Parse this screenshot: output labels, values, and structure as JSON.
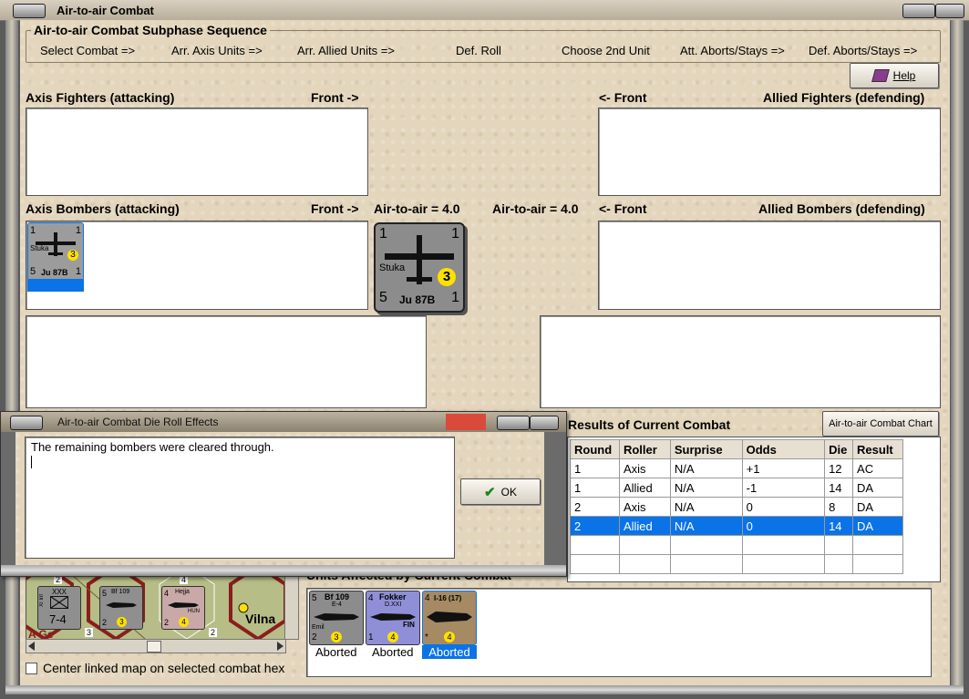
{
  "window": {
    "title": "Air-to-air Combat"
  },
  "sequence": {
    "title": "Air-to-air Combat Subphase Sequence",
    "steps": [
      "Select Combat =>",
      "Arr. Axis Units =>",
      "Arr. Allied Units =>",
      "Def. Roll",
      "Choose 2nd Unit",
      "Att. Aborts/Stays =>",
      "Def. Aborts/Stays =>"
    ]
  },
  "help_button": "Help",
  "labels": {
    "axis_fighters": "Axis Fighters (attacking)",
    "front_right": "Front ->",
    "front_left": "<- Front",
    "allied_fighters": "Allied Fighters (defending)",
    "axis_bombers": "Axis Bombers (attacking)",
    "allied_bombers": "Allied Bombers (defending)",
    "axis_air": "Air-to-air = 4.0",
    "allied_air": "Air-to-air = 4.0"
  },
  "units": {
    "stuka_small": {
      "top_left": "1",
      "top_right": "1",
      "name": "Stuka",
      "type": "Ju 87B",
      "bottom_left": "5",
      "bottom_right": "1",
      "circle": "3"
    },
    "stuka_large": {
      "top_left": "1",
      "top_right": "1",
      "name": "Stuka",
      "type": "Ju 87B",
      "bottom_left": "5",
      "bottom_right": "1",
      "circle": "3"
    }
  },
  "dialog": {
    "title": "Air-to-air Combat Die Roll Effects",
    "message": "The remaining bombers were cleared through.",
    "ok": "OK"
  },
  "results": {
    "title": "Results of Current Combat",
    "chart_button": "Air-to-air Combat Chart",
    "columns": [
      "Round",
      "Roller",
      "Surprise",
      "Odds",
      "Die",
      "Result"
    ],
    "rows": [
      [
        "1",
        "Axis",
        "N/A",
        "+1",
        "12",
        "AC"
      ],
      [
        "1",
        "Allied",
        "N/A",
        "-1",
        "14",
        "DA"
      ],
      [
        "2",
        "Axis",
        "N/A",
        "0",
        "8",
        "DA"
      ],
      [
        "2",
        "Allied",
        "N/A",
        "0",
        "14",
        "DA"
      ]
    ],
    "selected_row": 3
  },
  "map": {
    "city": "Vilna",
    "hex_labels": [
      "2",
      "4",
      "3",
      "2"
    ],
    "corps": {
      "size": "XXX",
      "strength": "7-4",
      "label": "XI Inf"
    },
    "bf109": {
      "name": "Bf 109",
      "sub": "E-4",
      "left": "5",
      "bl": "2",
      "circle": "3",
      "extra": "Emil"
    },
    "hejja": {
      "name": "Hejja",
      "left": "4",
      "bl": "2",
      "circle": "4",
      "nation": "HUN"
    },
    "corner_text": "A Ge"
  },
  "checkbox": {
    "label": "Center linked map on selected combat hex",
    "checked": false
  },
  "affected": {
    "title": "Units Affected by Current Combat",
    "units": [
      {
        "name": "Bf 109",
        "sub": "E-4",
        "tl": "5",
        "bl": "2",
        "circle": "3",
        "extra": "Emil",
        "status": "Aborted",
        "color": "#8c8c8c"
      },
      {
        "name": "Fokker",
        "sub": "D.XXI",
        "tl": "4",
        "bl": "1",
        "circle": "4",
        "extra": "FIN",
        "status": "Aborted",
        "color": "#8f8fd8"
      },
      {
        "name": "I-16 (17)",
        "sub": "",
        "tl": "4",
        "bl": "*",
        "circle": "4",
        "extra": "",
        "status": "Aborted",
        "color": "#a58a63"
      }
    ]
  }
}
